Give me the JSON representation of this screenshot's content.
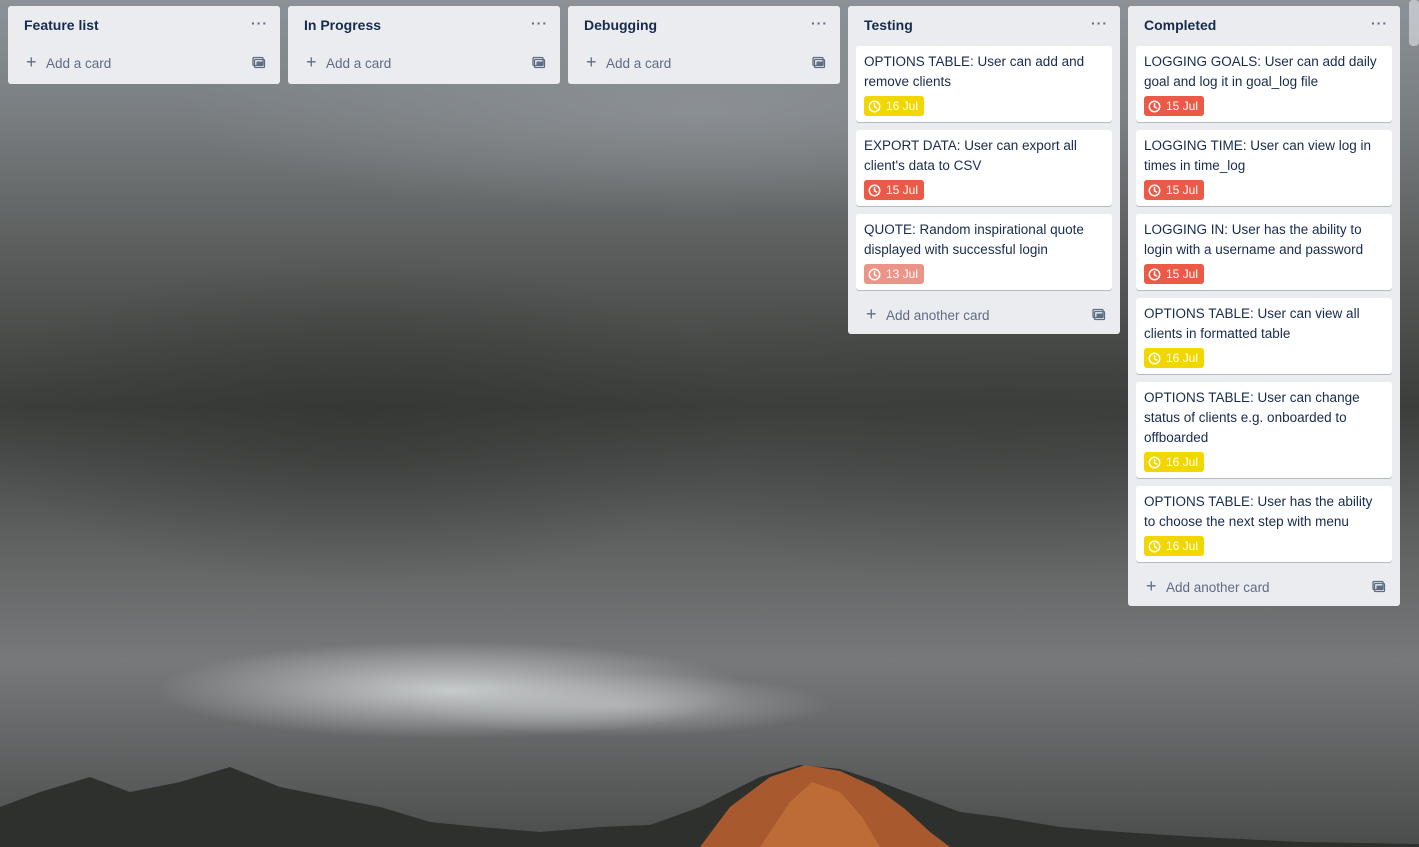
{
  "lists": [
    {
      "title": "Feature list",
      "menu": "···",
      "add_label": "Add a card",
      "cards": []
    },
    {
      "title": "In Progress",
      "menu": "···",
      "add_label": "Add a card",
      "cards": []
    },
    {
      "title": "Debugging",
      "menu": "···",
      "add_label": "Add a card",
      "cards": []
    },
    {
      "title": "Testing",
      "menu": "···",
      "add_label": "Add another card",
      "cards": [
        {
          "title": "OPTIONS TABLE: User can add and remove clients",
          "due": "16 Jul",
          "due_color": "#f2d600"
        },
        {
          "title": "EXPORT DATA: User can export all client's data to CSV",
          "due": "15 Jul",
          "due_color": "#eb5a46"
        },
        {
          "title": "QUOTE: Random inspirational quote displayed with successful login",
          "due": "13 Jul",
          "due_color": "#ec9488"
        }
      ]
    },
    {
      "title": "Completed",
      "menu": "···",
      "add_label": "Add another card",
      "cards": [
        {
          "title": "LOGGING GOALS: User can add daily goal and log it in goal_log file",
          "due": "15 Jul",
          "due_color": "#eb5a46"
        },
        {
          "title": "LOGGING TIME: User can view log in times in time_log",
          "due": "15 Jul",
          "due_color": "#eb5a46"
        },
        {
          "title": "LOGGING IN: User has the ability to login with a username and password",
          "due": "15 Jul",
          "due_color": "#eb5a46"
        },
        {
          "title": "OPTIONS TABLE: User can view all clients in formatted table",
          "due": "16 Jul",
          "due_color": "#f2d600"
        },
        {
          "title": "OPTIONS TABLE: User can change status of clients e.g. onboarded to offboarded",
          "due": "16 Jul",
          "due_color": "#f2d600"
        },
        {
          "title": "OPTIONS TABLE: User has the ability to choose the next step with menu",
          "due": "16 Jul",
          "due_color": "#f2d600"
        }
      ]
    }
  ],
  "icons": {
    "due": "clock-icon",
    "add": "plus-icon",
    "template": "card-template-icon",
    "menu": "more-icon"
  }
}
